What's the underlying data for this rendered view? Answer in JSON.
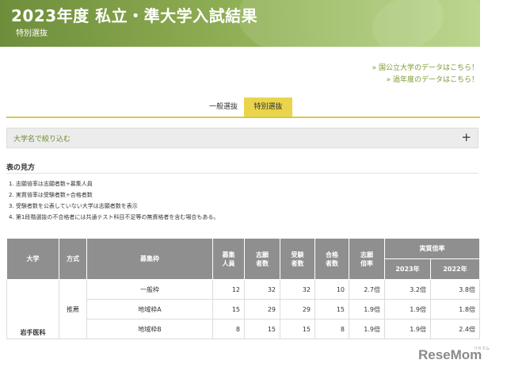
{
  "hero": {
    "title": "2023年度 私立・準大学入試結果",
    "subtitle": "特別選抜"
  },
  "links": [
    "» 国公立大学のデータはこちら！",
    "» 過年度のデータはこちら！"
  ],
  "tabs": [
    {
      "label": "一般選抜",
      "active": false
    },
    {
      "label": "特別選抜",
      "active": true
    }
  ],
  "filter": {
    "label": "大学名で絞り込む",
    "toggle": "+"
  },
  "howto": {
    "title": "表の見方",
    "notes": [
      "1. 志願倍率は志願者数÷募集人員",
      "2. 実質倍率は受験者数÷合格者数",
      "3. 受験者数を公表していない大学は志願者数を表示",
      "4. 第1段階選抜の不合格者には共通テスト科目不足等の無資格者を含む場合もある。"
    ]
  },
  "table": {
    "headers": {
      "university": "大学",
      "method": "方式",
      "frame": "募集枠",
      "capacity": [
        "募集",
        "人員"
      ],
      "applicants": [
        "志願",
        "者数"
      ],
      "examinees": [
        "受験",
        "者数"
      ],
      "passers": [
        "合格",
        "者数"
      ],
      "app_ratio": [
        "志願",
        "倍率"
      ],
      "real_ratio": "実質倍率",
      "y2023": "2023年",
      "y2022": "2022年"
    },
    "university": "岩手医科",
    "method": "推薦",
    "rows": [
      {
        "frame": "一般枠",
        "capacity": "12",
        "applicants": "32",
        "examinees": "32",
        "passers": "10",
        "app_ratio": "2.7倍",
        "r2023": "3.2倍",
        "r2022": "3.8倍"
      },
      {
        "frame": "地域枠A",
        "capacity": "15",
        "applicants": "29",
        "examinees": "29",
        "passers": "15",
        "app_ratio": "1.9倍",
        "r2023": "1.9倍",
        "r2022": "1.8倍"
      },
      {
        "frame": "地域枠B",
        "capacity": "8",
        "applicants": "15",
        "examinees": "15",
        "passers": "8",
        "app_ratio": "1.9倍",
        "r2023": "1.9倍",
        "r2022": "2.4倍"
      }
    ]
  },
  "watermark": {
    "brand": "ReseMom",
    "sub": "リセマム"
  },
  "colors": {
    "accent_green": "#7a9a30",
    "tab_active": "#e9d44c",
    "table_header": "#8f8f8f"
  }
}
